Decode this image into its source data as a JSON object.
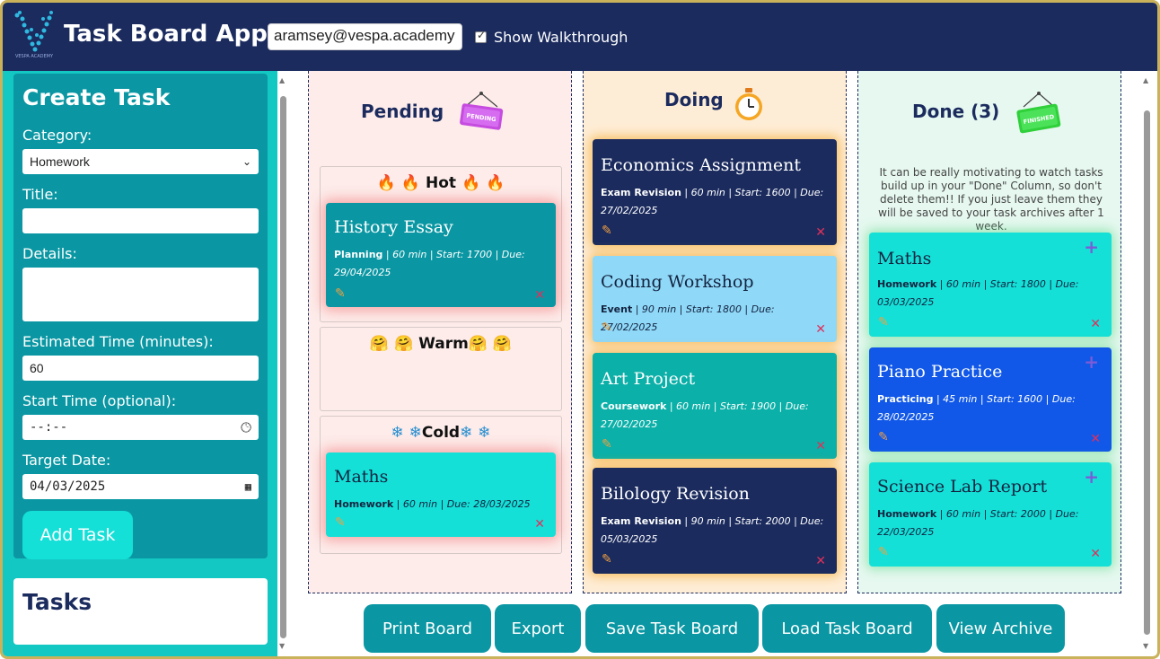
{
  "header": {
    "logo_text": "VESPA ACADEMY",
    "title": "Task Board App",
    "email": "aramsey@vespa.academy",
    "walkthrough_label": "Show Walkthrough",
    "walkthrough_checked": true
  },
  "create_task": {
    "heading": "Create Task",
    "category_label": "Category:",
    "category_value": "Homework",
    "title_label": "Title:",
    "title_value": "",
    "details_label": "Details:",
    "details_value": "",
    "est_label": "Estimated Time (minutes):",
    "est_value": "60",
    "start_label": "Start Time (optional):",
    "start_value": "--:--",
    "target_label": "Target Date:",
    "target_value": "04/03/2025",
    "add_button": "Add Task"
  },
  "tasks_panel": {
    "heading": "Tasks"
  },
  "columns": {
    "pending": {
      "title": "Pending",
      "sign_text": "PENDING",
      "sections": {
        "hot": {
          "label": "Hot",
          "emoji": "🔥"
        },
        "warm": {
          "label": "Warm",
          "emoji": "🤗"
        },
        "cold": {
          "label": "Cold",
          "emoji": "❄"
        }
      },
      "cards": [
        {
          "title": "History Essay",
          "category": "Planning",
          "meta": " | 60 min | Start: 1700 | Due: 29/04/2025"
        },
        {
          "title": "Maths",
          "category": "Homework",
          "meta": " | 60 min | Due: 28/03/2025"
        }
      ]
    },
    "doing": {
      "title": "Doing",
      "cards": [
        {
          "title": "Economics Assignment",
          "category": "Exam Revision",
          "meta": " | 60 min | Start: 1600 | Due: 27/02/2025"
        },
        {
          "title": "Coding Workshop",
          "category": "Event",
          "meta": " | 90 min | Start: 1800 | Due: 27/02/2025"
        },
        {
          "title": "Art Project",
          "category": "Coursework",
          "meta": " | 60 min | Start: 1900 | Due: 27/02/2025"
        },
        {
          "title": "Bilology Revision",
          "category": "Exam Revision",
          "meta": " | 90 min | Start: 2000 | Due: 05/03/2025"
        }
      ]
    },
    "done": {
      "title": "Done (3)",
      "sign_text": "FINISHED",
      "info": "It can be really motivating to watch tasks build up in your \"Done\" Column, so don't delete them!! If you just leave them they will be saved to your task archives after 1 week.",
      "cards": [
        {
          "title": "Maths",
          "category": "Homework",
          "meta": " | 60 min | Start: 1800 | Due: 03/03/2025"
        },
        {
          "title": "Piano Practice",
          "category": "Practicing",
          "meta": " | 45 min | Start: 1600 | Due: 28/02/2025"
        },
        {
          "title": "Science Lab Report",
          "category": "Homework",
          "meta": " | 60 min | Start: 2000 | Due: 22/03/2025"
        }
      ]
    }
  },
  "bottom_buttons": {
    "print": "Print Board",
    "export": "Export",
    "save": "Save Task Board",
    "load": "Load Task Board",
    "archive": "View Archive"
  },
  "colors": {
    "header_bg": "#1b2b5e",
    "sidebar_bg": "#13c8c3",
    "teal_dark": "#0a97a3",
    "navy_card": "#1b2b5e",
    "cyan_card": "#14e0d8",
    "light_blue_card": "#8fd8f8",
    "blue_card": "#1158e8",
    "teal_card": "#0bb0a8"
  }
}
